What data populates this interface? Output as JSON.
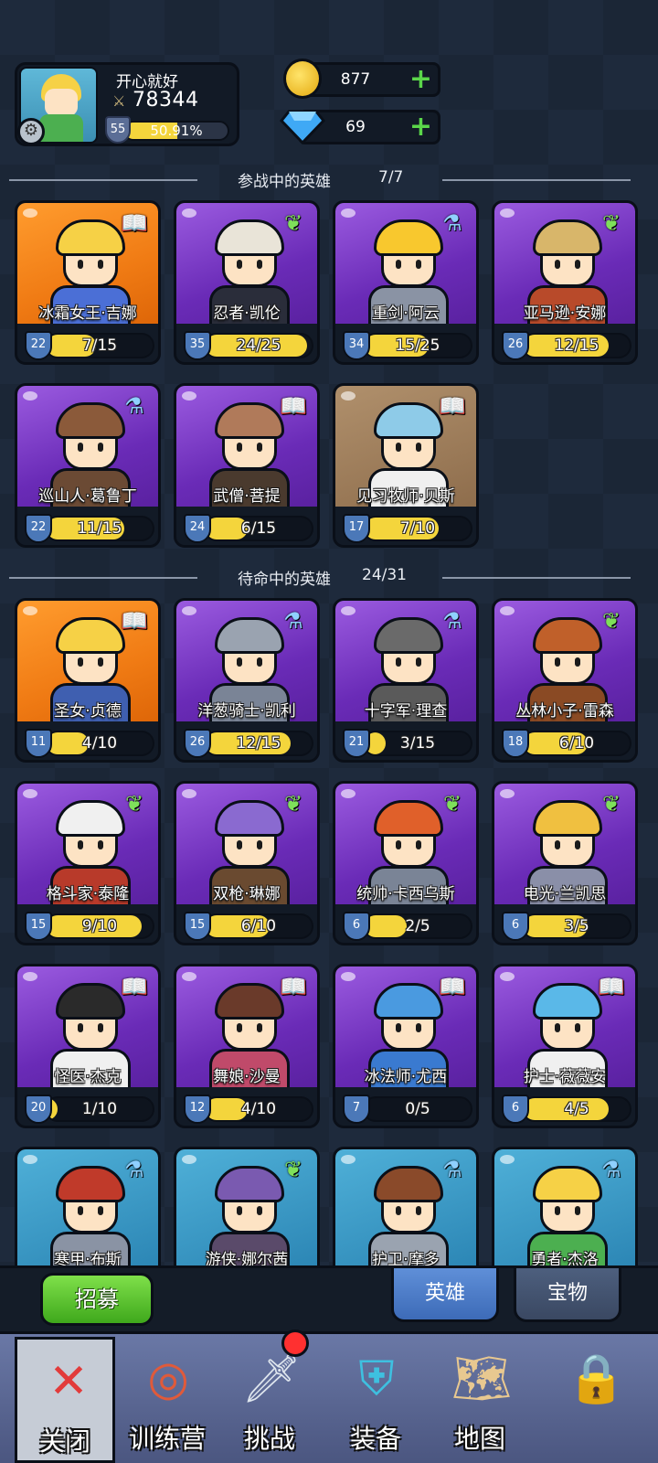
{
  "profile": {
    "name": "开心就好",
    "power": "78344",
    "level": "55",
    "xp_text": "50.91%",
    "xp_fraction": 0.5091
  },
  "resources": {
    "gold": "877",
    "gems": "69"
  },
  "sections": {
    "active_title": "参战中的英雄",
    "active_count": "7/7",
    "standby_title": "待命中的英雄",
    "standby_count": "24/31"
  },
  "active_heroes": [
    {
      "name": "冰霜女王·吉娜",
      "level": "22",
      "shards": "7/15",
      "bg": "orange",
      "badge": "book",
      "hair": "#f6d146",
      "body": "#4b6fd6"
    },
    {
      "name": "忍者·凯伦",
      "level": "35",
      "shards": "24/25",
      "bg": "purple",
      "badge": "wing",
      "hair": "#e9e4d8",
      "body": "#2a2d3a"
    },
    {
      "name": "重剑·阿云",
      "level": "34",
      "shards": "15/25",
      "bg": "purple",
      "badge": "potion",
      "hair": "#f8c82e",
      "body": "#8a93a4"
    },
    {
      "name": "亚马逊·安娜",
      "level": "26",
      "shards": "12/15",
      "bg": "purple",
      "badge": "wing",
      "hair": "#d8b66a",
      "body": "#b84a2a"
    },
    {
      "name": "巡山人·葛鲁丁",
      "level": "22",
      "shards": "11/15",
      "bg": "purple",
      "badge": "potion",
      "hair": "#8b5a3a",
      "body": "#6b4a34"
    },
    {
      "name": "武僧·菩提",
      "level": "24",
      "shards": "6/15",
      "bg": "purple",
      "badge": "book",
      "hair": "#b07a5a",
      "body": "#4a3a2e"
    },
    {
      "name": "见习牧师·贝斯",
      "level": "17",
      "shards": "7/10",
      "bg": "brown",
      "badge": "book",
      "hair": "#8ecbe8",
      "body": "#f0f0f0"
    }
  ],
  "standby_heroes": [
    {
      "name": "圣女·贞德",
      "level": "11",
      "shards": "4/10",
      "bg": "orange",
      "badge": "book",
      "hair": "#f6d146",
      "body": "#3f5fb0"
    },
    {
      "name": "洋葱骑士·凯利",
      "level": "26",
      "shards": "12/15",
      "bg": "purple",
      "badge": "potion",
      "hair": "#9aa3b0",
      "body": "#7a8496"
    },
    {
      "name": "十字军·理查",
      "level": "21",
      "shards": "3/15",
      "bg": "purple",
      "badge": "potion",
      "hair": "#6a6a6a",
      "body": "#5a5a5a"
    },
    {
      "name": "丛林小子·雷森",
      "level": "18",
      "shards": "6/10",
      "bg": "purple",
      "badge": "wing",
      "hair": "#c0602a",
      "body": "#8a4a24"
    },
    {
      "name": "格斗家·泰隆",
      "level": "15",
      "shards": "9/10",
      "bg": "purple",
      "badge": "wing",
      "hair": "#f0f0f0",
      "body": "#b83a2a"
    },
    {
      "name": "双枪·琳娜",
      "level": "15",
      "shards": "6/10",
      "bg": "purple",
      "badge": "wing",
      "hair": "#8a6ad0",
      "body": "#6a4a30"
    },
    {
      "name": "统帅·卡西乌斯",
      "level": "6",
      "shards": "2/5",
      "bg": "purple",
      "badge": "wing",
      "hair": "#e0602a",
      "body": "#7a8496"
    },
    {
      "name": "电光·兰凯思",
      "level": "6",
      "shards": "3/5",
      "bg": "purple",
      "badge": "wing",
      "hair": "#f0c040",
      "body": "#8a8fa8"
    },
    {
      "name": "怪医·杰克",
      "level": "20",
      "shards": "1/10",
      "bg": "purple",
      "badge": "book",
      "hair": "#2a2a2a",
      "body": "#f0f0f0"
    },
    {
      "name": "舞娘·沙曼",
      "level": "12",
      "shards": "4/10",
      "bg": "purple",
      "badge": "book",
      "hair": "#6a3a2a",
      "body": "#c04a6a"
    },
    {
      "name": "冰法师·尤西",
      "level": "7",
      "shards": "0/5",
      "bg": "purple",
      "badge": "book",
      "hair": "#4a9ae0",
      "body": "#3a7ad0"
    },
    {
      "name": "护士·薇薇安",
      "level": "6",
      "shards": "4/5",
      "bg": "purple",
      "badge": "book",
      "hair": "#5ab8e8",
      "body": "#f0f0f0"
    },
    {
      "name": "寒甲·布斯",
      "level": "",
      "shards": "",
      "bg": "blue",
      "badge": "potion",
      "hair": "#c03a2a",
      "body": "#8a93a4"
    },
    {
      "name": "游侠·娜尔茜",
      "level": "",
      "shards": "",
      "bg": "blue",
      "badge": "wing",
      "hair": "#7a5ab0",
      "body": "#5a4a6a"
    },
    {
      "name": "护卫·摩多",
      "level": "",
      "shards": "",
      "bg": "blue",
      "badge": "potion",
      "hair": "#8a4a2a",
      "body": "#9aa3b0"
    },
    {
      "name": "勇者·杰洛",
      "level": "",
      "shards": "",
      "bg": "blue",
      "badge": "potion",
      "hair": "#f6d146",
      "body": "#4caf50"
    }
  ],
  "actions": {
    "recruit": "招募",
    "tab_hero": "英雄",
    "tab_treasure": "宝物"
  },
  "nav": {
    "close": "关闭",
    "camp": "训练营",
    "challenge": "挑战",
    "equip": "装备",
    "map": "地图"
  },
  "colors": {
    "bar_fill": "#f4d53c",
    "accent_green": "#5bd64a",
    "notification": "#ff3030"
  }
}
